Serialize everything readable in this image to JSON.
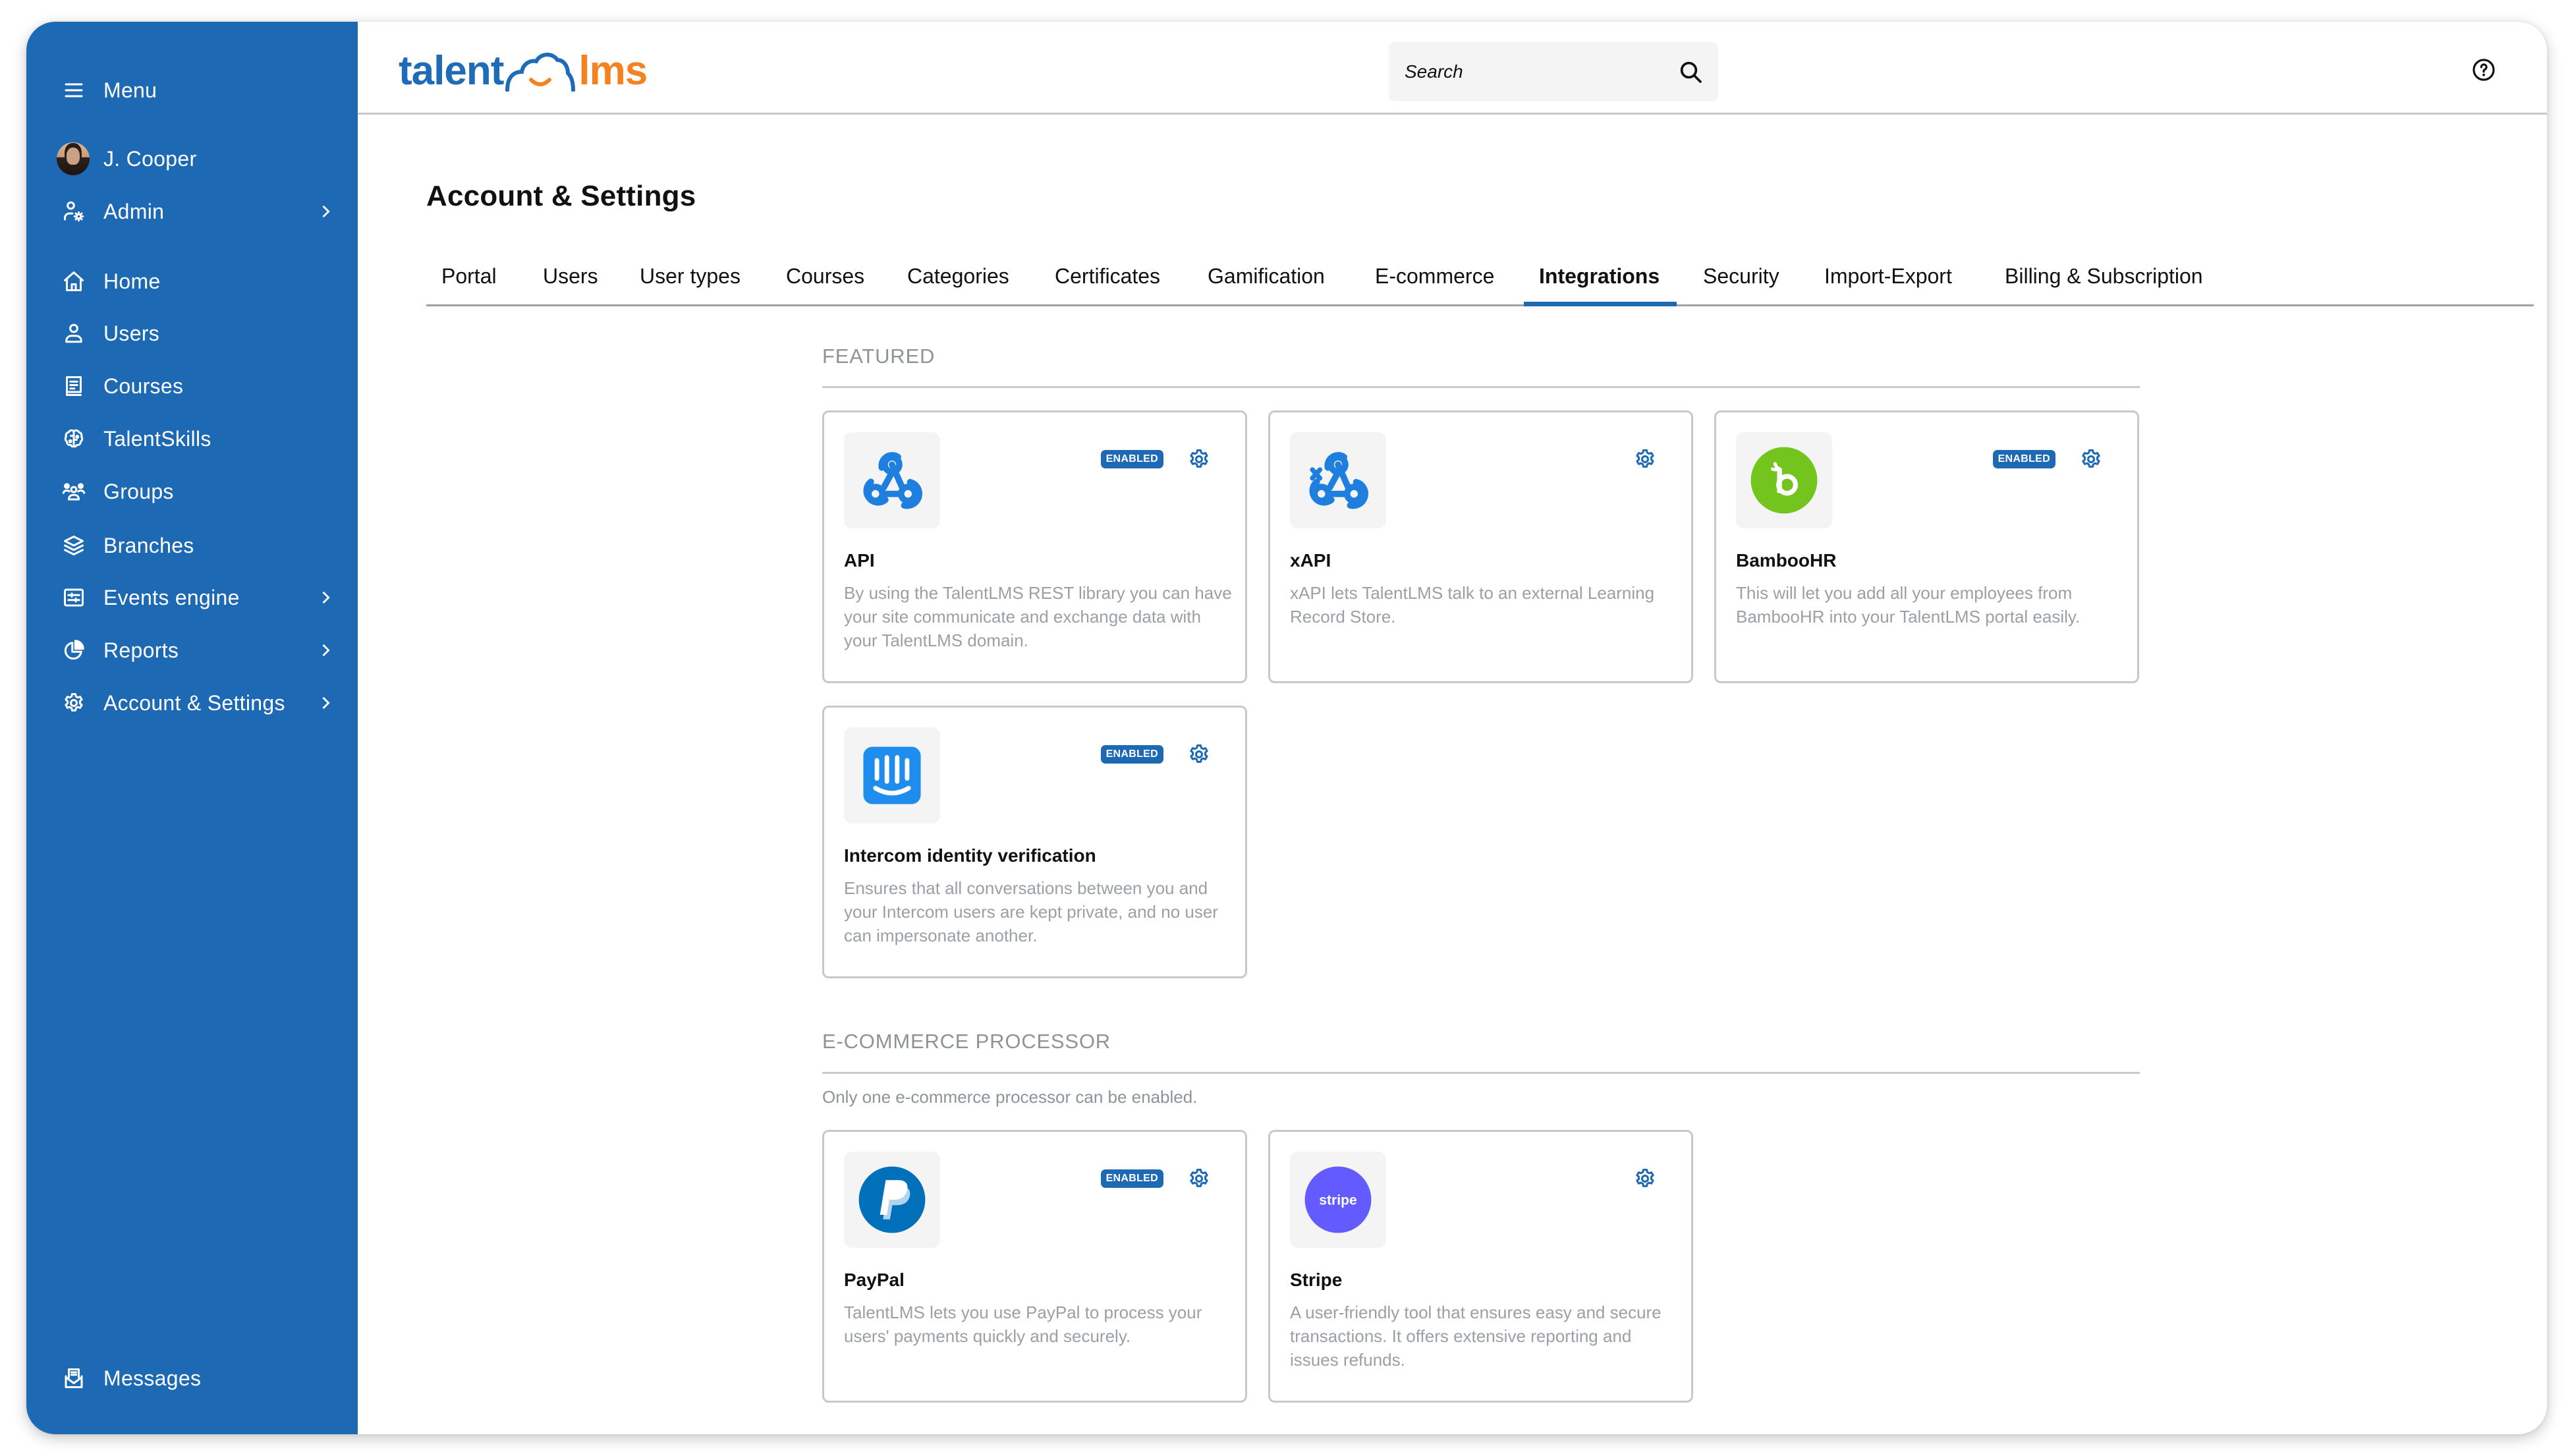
{
  "sidebar": {
    "menu_label": "Menu",
    "user_name": "J. Cooper",
    "admin_label": "Admin",
    "items": [
      {
        "label": "Home",
        "icon": "home-icon"
      },
      {
        "label": "Users",
        "icon": "user-icon"
      },
      {
        "label": "Courses",
        "icon": "book-icon"
      },
      {
        "label": "TalentSkills",
        "icon": "brain-icon"
      },
      {
        "label": "Groups",
        "icon": "groups-icon"
      },
      {
        "label": "Branches",
        "icon": "layers-icon"
      },
      {
        "label": "Events engine",
        "icon": "sliders-icon"
      },
      {
        "label": "Reports",
        "icon": "pie-chart-icon"
      },
      {
        "label": "Account & Settings",
        "icon": "gear-icon"
      }
    ],
    "messages_label": "Messages"
  },
  "header": {
    "logo_left": "talent",
    "logo_right": "lms",
    "search_placeholder": "Search"
  },
  "page": {
    "title": "Account & Settings",
    "tabs": [
      {
        "label": "Portal"
      },
      {
        "label": "Users"
      },
      {
        "label": "User types"
      },
      {
        "label": "Courses"
      },
      {
        "label": "Categories"
      },
      {
        "label": "Certificates"
      },
      {
        "label": "Gamification"
      },
      {
        "label": "E-commerce"
      },
      {
        "label": "Integrations",
        "active": true
      },
      {
        "label": "Security"
      },
      {
        "label": "Import-Export"
      },
      {
        "label": "Billing & Subscription"
      }
    ]
  },
  "featured": {
    "title": "FEATURED",
    "cards": [
      {
        "name": "API",
        "enabled": true,
        "badge": "ENABLED",
        "description": "By using the TalentLMS REST library you can have your site communicate and exchange data with your TalentLMS domain."
      },
      {
        "name": "xAPI",
        "enabled": false,
        "description": "xAPI lets TalentLMS talk to an external Learning Record Store."
      },
      {
        "name": "BambooHR",
        "enabled": true,
        "badge": "ENABLED",
        "description": "This will let you add all your employees from BambooHR into your TalentLMS portal easily."
      },
      {
        "name": "Intercom identity verification",
        "enabled": true,
        "badge": "ENABLED",
        "description": "Ensures that all conversations between you and your Intercom users are kept private, and no user can impersonate another."
      }
    ]
  },
  "ecommerce": {
    "title": "E-COMMERCE PROCESSOR",
    "subtitle": "Only one e-commerce processor can be enabled.",
    "cards": [
      {
        "name": "PayPal",
        "enabled": true,
        "badge": "ENABLED",
        "description": "TalentLMS lets you use PayPal to process your users' payments quickly and securely."
      },
      {
        "name": "Stripe",
        "enabled": false,
        "logo_text": "stripe",
        "description": "A user-friendly tool that ensures easy and secure transactions. It offers extensive reporting and issues refunds."
      }
    ]
  },
  "colors": {
    "sidebar": "#1d69b3",
    "accent": "#1d69b3",
    "logo_blue": "#1e6bb8",
    "logo_orange": "#f5821f",
    "bamboo_green": "#73c41d",
    "intercom_blue": "#1f8ded",
    "paypal_blue": "#0070ba",
    "stripe_purple": "#635bff"
  }
}
